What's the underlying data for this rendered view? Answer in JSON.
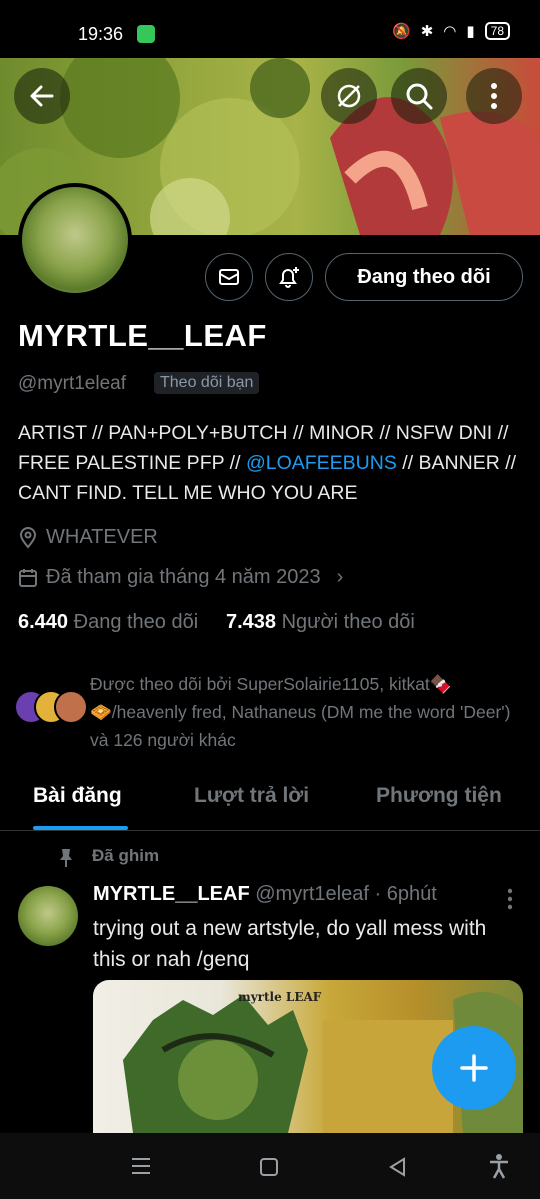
{
  "status_bar": {
    "time": "19:36",
    "battery": "78"
  },
  "profile": {
    "name": "MYRTLE__LEAF",
    "handle": "@myrt1eleaf",
    "follows_you": "Theo dõi bạn",
    "follow_button": "Đang theo dõi",
    "bio_part1": "ARTIST // PAN+POLY+BUTCH // MINOR // NSFW DNI // FREE PALESTINE  PFP // ",
    "bio_link": "@LOAFEEBUNS",
    "bio_part2": " // BANNER // CANT FIND. TELL ME WHO YOU ARE",
    "location": "WHATEVER",
    "joined": "Đã tham gia tháng 4 năm 2023",
    "following_count": "6.440",
    "following_label": "Đang theo dõi",
    "followers_count": "7.438",
    "followers_label": "Người theo dõi",
    "followed_by": "Được theo dõi bởi SuperSolairie1105, kitkat🍫🧇/heavenly fred, Nathaneus (DM me the word 'Deer') và 126 người khác"
  },
  "tabs": [
    {
      "label": "Bài đăng"
    },
    {
      "label": "Lượt trả lời"
    },
    {
      "label": "Phương tiện"
    }
  ],
  "post": {
    "pinned_label": "Đã ghim",
    "author": "MYRTLE__LEAF",
    "handle_time": "@myrt1eleaf · 6phút",
    "text": "trying out a new artstyle, do yall mess with this or nah /genq",
    "image_caption": "myrtle LEAF"
  },
  "icons": {
    "back": "back-arrow-icon",
    "no_sync": "no-sync-icon",
    "search": "search-icon",
    "more": "more-vertical-icon",
    "message": "mail-icon",
    "notify": "bell-plus-icon",
    "location": "location-pin-icon",
    "calendar": "calendar-icon",
    "pin": "pin-icon",
    "compose": "plus-icon"
  },
  "colors": {
    "accent": "#1d9bf0",
    "background": "#000000",
    "muted": "#71767b"
  }
}
